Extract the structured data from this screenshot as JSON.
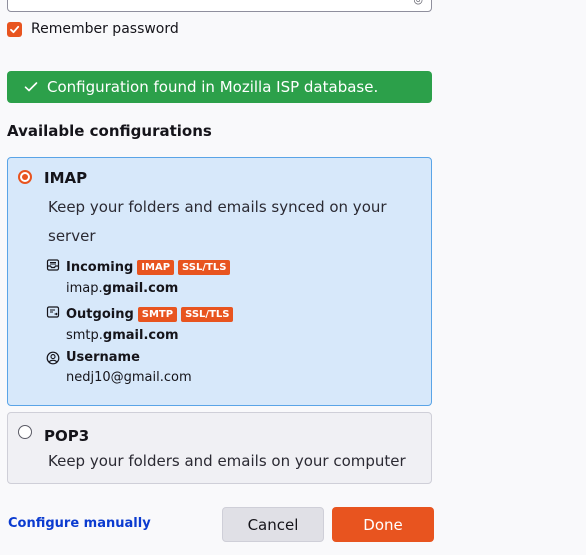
{
  "remember": {
    "label": "Remember password",
    "checked": true
  },
  "status": {
    "message": "Configuration found in Mozilla ISP database.",
    "color": "#2ca04a",
    "icon": "checkmark-icon"
  },
  "available_title": "Available configurations",
  "configs": {
    "imap": {
      "title": "IMAP",
      "description": "Keep your folders and emails synced on your server",
      "selected": true,
      "incoming": {
        "label": "Incoming",
        "badges": [
          "IMAP",
          "SSL/TLS"
        ],
        "host_prefix": "imap.",
        "host_domain": "gmail.com"
      },
      "outgoing": {
        "label": "Outgoing",
        "badges": [
          "SMTP",
          "SSL/TLS"
        ],
        "host_prefix": "smtp.",
        "host_domain": "gmail.com"
      },
      "username": {
        "label": "Username",
        "value": "nedj10@gmail.com"
      }
    },
    "pop3": {
      "title": "POP3",
      "description": "Keep your folders and emails on your computer",
      "selected": false
    }
  },
  "footer": {
    "configure_manually": "Configure manually",
    "cancel": "Cancel",
    "done": "Done"
  },
  "colors": {
    "accent": "#e8541f",
    "selected_bg": "#d7e8fa",
    "selected_border": "#5aa4e7",
    "link": "#0b3bd0"
  }
}
